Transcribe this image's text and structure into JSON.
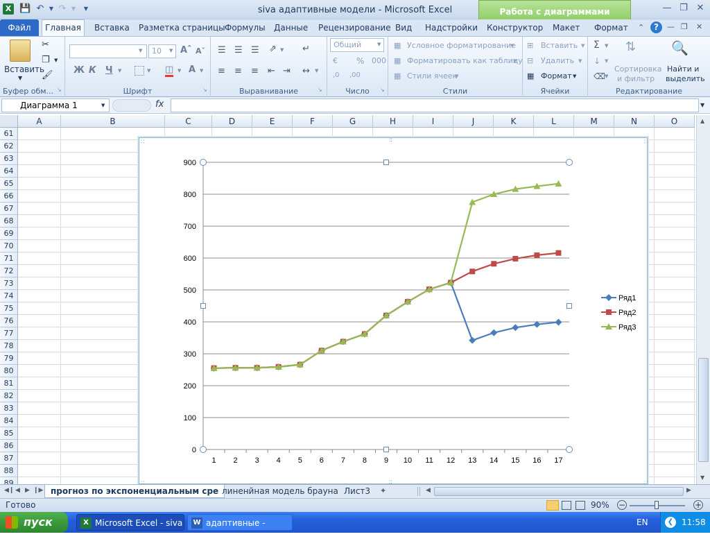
{
  "window": {
    "title": "siva адаптивные модели  -  Microsoft Excel",
    "context_tab": "Работа с диаграммами"
  },
  "tabs": [
    "Файл",
    "Главная",
    "Вставка",
    "Разметка страницы",
    "Формулы",
    "Данные",
    "Рецензирование",
    "Вид",
    "Надстройки",
    "Конструктор",
    "Макет",
    "Формат"
  ],
  "ribbon": {
    "clipboard": {
      "paste": "Вставить",
      "label": "Буфер обм..."
    },
    "font": {
      "size": "10",
      "label": "Шрифт",
      "bold": "Ж",
      "italic": "К",
      "underline": "Ч"
    },
    "alignment": {
      "label": "Выравнивание"
    },
    "number": {
      "format": "Общий",
      "label": "Число"
    },
    "styles": {
      "conditional": "Условное форматирование",
      "as_table": "Форматировать как таблицу",
      "cell_styles": "Стили ячеек",
      "label": "Стили"
    },
    "cells": {
      "insert": "Вставить",
      "delete": "Удалить",
      "format": "Формат",
      "label": "Ячейки"
    },
    "editing": {
      "sort_line1": "Сортировка",
      "sort_line2": "и фильтр",
      "find_line1": "Найти и",
      "find_line2": "выделить",
      "label": "Редактирование"
    }
  },
  "formula_bar": {
    "name_box": "Диаграмма 1",
    "fx": "fx"
  },
  "columns": [
    "A",
    "B",
    "C",
    "D",
    "E",
    "F",
    "G",
    "H",
    "I",
    "J",
    "K",
    "L",
    "M",
    "N",
    "O"
  ],
  "rows": [
    "61",
    "62",
    "63",
    "64",
    "65",
    "66",
    "67",
    "68",
    "69",
    "70",
    "71",
    "72",
    "73",
    "74",
    "75",
    "76",
    "77",
    "78",
    "79",
    "80",
    "81",
    "82",
    "83",
    "84",
    "85",
    "86",
    "87",
    "88",
    "89"
  ],
  "chart_data": {
    "type": "line",
    "x": [
      1,
      2,
      3,
      4,
      5,
      6,
      7,
      8,
      9,
      10,
      11,
      12,
      13,
      14,
      15,
      16,
      17
    ],
    "ylim": [
      0,
      900
    ],
    "yticks": [
      0,
      100,
      200,
      300,
      400,
      500,
      600,
      700,
      800,
      900
    ],
    "grid": true,
    "legend_position": "right",
    "series": [
      {
        "name": "Ряд1",
        "color": "#4a7ebb",
        "marker": "diamond",
        "values": [
          255,
          256,
          256,
          259,
          266,
          310,
          338,
          362,
          420,
          463,
          502,
          523,
          342,
          366,
          382,
          392,
          399
        ]
      },
      {
        "name": "Ряд2",
        "color": "#be4b48",
        "marker": "square",
        "values": [
          255,
          256,
          256,
          259,
          266,
          310,
          338,
          362,
          420,
          463,
          502,
          523,
          558,
          582,
          598,
          609,
          616
        ]
      },
      {
        "name": "Ряд3",
        "color": "#98b954",
        "marker": "triangle",
        "values": [
          255,
          256,
          256,
          259,
          266,
          310,
          338,
          362,
          420,
          463,
          502,
          523,
          775,
          800,
          816,
          825,
          833
        ]
      }
    ]
  },
  "sheets": [
    "прогноз по экспоненциальным сре",
    "линенйная модель брауна",
    "Лист3"
  ],
  "status": {
    "ready": "Готово",
    "zoom": "90%"
  },
  "taskbar": {
    "start": "пуск",
    "task1": "Microsoft Excel - siva ...",
    "task2": "адаптивные - Micros...",
    "lang": "EN",
    "clock": "11:58"
  }
}
